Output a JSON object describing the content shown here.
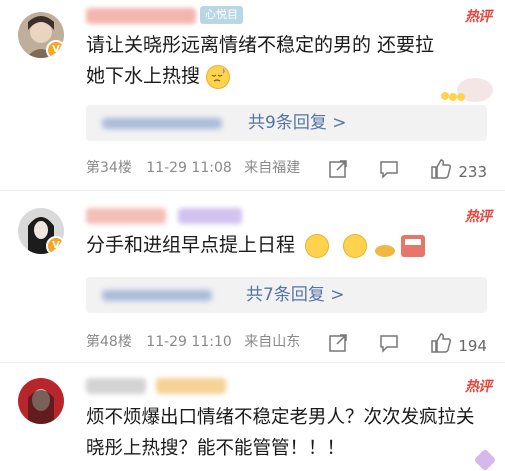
{
  "comments": [
    {
      "name_badge": "心悦目",
      "hot_label": "热评",
      "text": "请让关晓彤远离情绪不稳定的男的 还要拉她下水上热搜",
      "reply_count": "共9条回复 >",
      "floor": "第34楼",
      "date": "11-29 11:08",
      "location": "来自福建",
      "likes": "233"
    },
    {
      "hot_label": "热评",
      "text": "分手和进组早点提上日程",
      "reply_count": "共7条回复 >",
      "floor": "第48楼",
      "date": "11-29 11:10",
      "location": "来自山东",
      "likes": "194"
    },
    {
      "hot_label": "热评",
      "text": "烦不烦爆出口情绪不稳定老男人？次次发疯拉关晓彤上热搜？能不能管管！！！"
    }
  ],
  "icons": [
    "verified-badge-icon",
    "share-icon",
    "comment-icon",
    "like-icon",
    "emoji-icon"
  ],
  "colors": {
    "hot": "#e8453c",
    "link": "#5474a8",
    "meta": "#8a8a8a",
    "badge": "#f5a623"
  }
}
